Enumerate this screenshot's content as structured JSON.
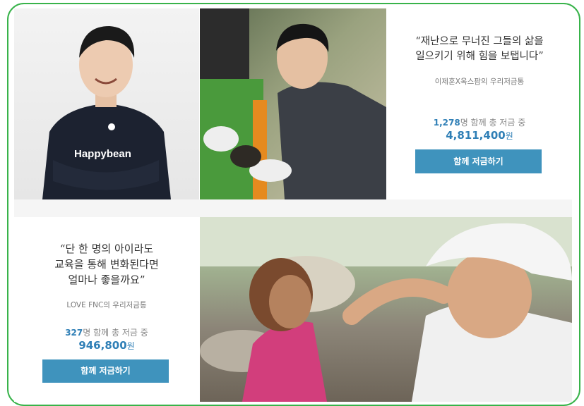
{
  "campaign1": {
    "quote_line1": "“재난으로 무너진 그들의 삶을",
    "quote_line2": "일으키기 위해 힘을 보탭니다”",
    "source": "이제훈X옥스팜의 우리저금통",
    "count": "1,278",
    "count_suffix": "명 함께 총 저금 중",
    "amount": "4,811,400",
    "amount_unit": "원",
    "button_label": "함께 저금하기",
    "shirt_text": "Happybean"
  },
  "campaign2": {
    "quote_line1": "“단 한 명의 아이라도",
    "quote_line2": "교육을 통해 변화된다면",
    "quote_line3": "얼마나 좋을까요”",
    "source": "LOVE FNC의 우리저금통",
    "count": "327",
    "count_suffix": "명 함께 총 저금 중",
    "amount": "946,800",
    "amount_unit": "원",
    "button_label": "함께 저금하기"
  },
  "colors": {
    "accent": "#3f93bd",
    "frame": "#38b34a",
    "amount_text": "#2f7fb6"
  }
}
